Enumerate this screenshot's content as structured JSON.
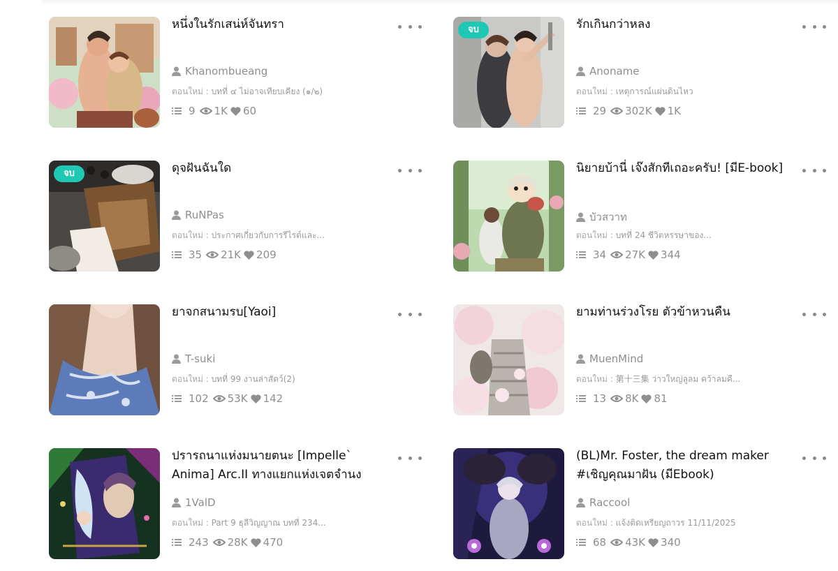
{
  "novels": [
    {
      "title": "หนึ่งในรักเสน่ห์จันทรา",
      "author": "Khanombueang",
      "latest_label": "ตอนใหม่ : ",
      "latest": "บทที่ ๔ ไม่อาจเทียบเคียง (๑/๒)",
      "chapters": "9",
      "views": "1K",
      "likes": "60",
      "badge": ""
    },
    {
      "title": "รักเกินกว่าหลง",
      "author": "Anoname",
      "latest_label": "ตอนใหม่ : ",
      "latest": "เหตุการณ์แผ่นดินไหว",
      "chapters": "29",
      "views": "302K",
      "likes": "1K",
      "badge": "จบ"
    },
    {
      "title": "ดุจฝันฉันใด",
      "author": "RuNPas",
      "latest_label": "ตอนใหม่ : ",
      "latest": "ประกาศเกี่ยวกับการรีไรต์และ...",
      "chapters": "35",
      "views": "21K",
      "likes": "209",
      "badge": "จบ"
    },
    {
      "title": "นิยายบ้านี่ เจ๊งสักทีเถอะครับ! [มีE-book]",
      "author": "บัวสวาท",
      "latest_label": "ตอนใหม่ : ",
      "latest": "บทที่ 24 ชีวิตหรรษาของ...",
      "chapters": "34",
      "views": "27K",
      "likes": "344",
      "badge": ""
    },
    {
      "title": "ยาจกสนามรบ[Yaoi]",
      "author": "T-suki",
      "latest_label": "ตอนใหม่ : ",
      "latest": "บทที่ 99 งานล่าสัตว์(2)",
      "chapters": "102",
      "views": "53K",
      "likes": "142",
      "badge": ""
    },
    {
      "title": "ยามท่านร่วงโรย ตัวข้าหวนคืน",
      "author": "MuenMind",
      "latest_label": "ตอนใหม่ : ",
      "latest": "第十三集 ว่าวใหญ่ลูลม คว้าลมคื...",
      "chapters": "13",
      "views": "8K",
      "likes": "81",
      "badge": ""
    },
    {
      "title": "ปรารถนาแห่งมนายตนะ [Impelle` Anima] Arc.II ทางแยกแห่งเจตจำนง",
      "author": "1ValD",
      "latest_label": "ตอนใหม่ : ",
      "latest": "Part 9 ธุลีวิญญาณ บทที่ 234...",
      "chapters": "243",
      "views": "28K",
      "likes": "470",
      "badge": ""
    },
    {
      "title": "(BL)Mr. Foster, the dream maker #เชิญคุณมาฝัน (มีEbook)",
      "author": "Raccool",
      "latest_label": "ตอนใหม่ : ",
      "latest": "แจ้งติดเหรียญถาวร 11/11/2025",
      "chapters": "68",
      "views": "43K",
      "likes": "340",
      "badge": ""
    }
  ]
}
